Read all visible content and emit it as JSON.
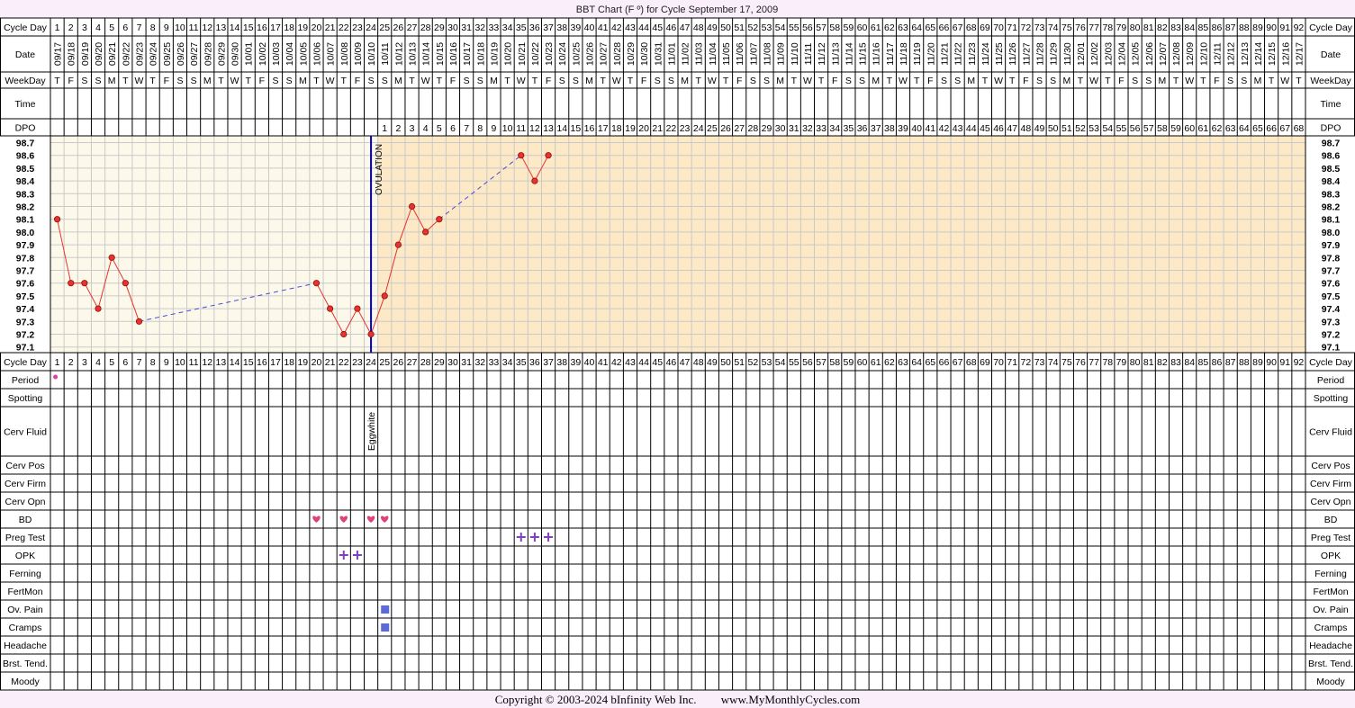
{
  "title": "BBT Chart (F º) for Cycle September 17, 2009",
  "row_labels": {
    "cycle_day": "Cycle Day",
    "date": "Date",
    "weekday": "WeekDay",
    "time": "Time",
    "dpo": "DPO",
    "cycle_day_2": "Cycle Day",
    "period": "Period",
    "spotting": "Spotting",
    "cerv_fluid": "Cerv Fluid",
    "cerv_pos": "Cerv Pos",
    "cerv_firm": "Cerv Firm",
    "cerv_opn": "Cerv Opn",
    "bd": "BD",
    "preg_test": "Preg Test",
    "opk": "OPK",
    "ferning": "Ferning",
    "fertmon": "FertMon",
    "ov_pain": "Ov. Pain",
    "cramps": "Cramps",
    "headache": "Headache",
    "brst_tend": "Brst. Tend.",
    "moody": "Moody"
  },
  "dates": [
    "09/17",
    "09/18",
    "09/19",
    "09/20",
    "09/21",
    "09/22",
    "09/23",
    "09/24",
    "09/25",
    "09/26",
    "09/27",
    "09/28",
    "09/29",
    "09/30",
    "10/01",
    "10/02",
    "10/03",
    "10/04",
    "10/05",
    "10/06",
    "10/07",
    "10/08",
    "10/09",
    "10/10",
    "10/11",
    "10/12",
    "10/13",
    "10/14",
    "10/15",
    "10/16",
    "10/17",
    "10/18",
    "10/19",
    "10/20",
    "10/21",
    "10/22",
    "10/23",
    "10/24",
    "10/25",
    "10/26",
    "10/27",
    "10/28",
    "10/29",
    "10/30",
    "10/31",
    "11/01",
    "11/02",
    "11/03",
    "11/04",
    "11/05",
    "11/06",
    "11/07",
    "11/08",
    "11/09",
    "11/10",
    "11/11",
    "11/12",
    "11/13",
    "11/14",
    "11/15",
    "11/16",
    "11/17",
    "11/18",
    "11/19",
    "11/20",
    "11/21",
    "11/22",
    "11/23",
    "11/24",
    "11/25",
    "11/26",
    "11/27",
    "11/28",
    "11/29",
    "11/30",
    "12/01",
    "12/02",
    "12/03",
    "12/04",
    "12/05",
    "12/06",
    "12/07",
    "12/08",
    "12/09",
    "12/10",
    "12/11",
    "12/12",
    "12/13",
    "12/14",
    "12/15",
    "12/16",
    "12/17"
  ],
  "weekdays": [
    "T",
    "F",
    "S",
    "S",
    "M",
    "T",
    "W",
    "T",
    "F",
    "S",
    "S",
    "M",
    "T",
    "W",
    "T",
    "F",
    "S",
    "S",
    "M",
    "T",
    "W",
    "T",
    "F",
    "S",
    "S",
    "M",
    "T",
    "W",
    "T",
    "F",
    "S",
    "S",
    "M",
    "T",
    "W",
    "T",
    "F",
    "S",
    "S",
    "M",
    "T",
    "W",
    "T",
    "F",
    "S",
    "S",
    "M",
    "T",
    "W",
    "T",
    "F",
    "S",
    "S",
    "M",
    "T",
    "W",
    "T",
    "F",
    "S",
    "S",
    "M",
    "T",
    "W",
    "T",
    "F",
    "S",
    "S",
    "M",
    "T",
    "W",
    "T",
    "F",
    "S",
    "S",
    "M",
    "T",
    "W",
    "T",
    "F",
    "S",
    "S",
    "M",
    "T",
    "W",
    "T",
    "F",
    "S",
    "S",
    "M",
    "T",
    "W",
    "T"
  ],
  "ovulation_label": "OVULATION",
  "cerv_fluid_entries": [
    {
      "day": 24,
      "label": "Eggwhite"
    }
  ],
  "markers": {
    "period": [
      1
    ],
    "bd": [
      20,
      22,
      24,
      25
    ],
    "preg_test": [
      35,
      36,
      37
    ],
    "opk": [
      22,
      23
    ],
    "ov_pain": [
      25
    ],
    "cramps": [
      25
    ]
  },
  "colors": {
    "page_bg": "#fbeefb",
    "grid_line": "#c9c9c9",
    "pre_ovulation_bg": "#fdf9ea",
    "post_ovulation_bg": "#fde9c6",
    "temp_line": "#e8322e",
    "ovulation_line": "#0000cc",
    "gap_line": "#4a4ad8",
    "bd_heart": "#e0407e",
    "plus_sign": "#8040c0",
    "square": "#5b6bd8",
    "period_dot": "#e0409e"
  },
  "footer": {
    "copyright": "Copyright © 2003-2024 bInfinity Web Inc.",
    "site": "www.MyMonthlyCycles.com"
  },
  "chart_data": {
    "type": "line",
    "title": "BBT Chart (F º) for Cycle September 17, 2009",
    "xlabel": "Cycle Day",
    "ylabel": "",
    "x_range": [
      1,
      92
    ],
    "ylim": [
      97.1,
      98.7
    ],
    "y_ticks": [
      "98.7",
      "98.6",
      "98.5",
      "98.4",
      "98.3",
      "98.2",
      "98.1",
      "98.0",
      "97.9",
      "97.8",
      "97.7",
      "97.6",
      "97.5",
      "97.4",
      "97.3",
      "97.2",
      "97.1"
    ],
    "ovulation_day": 24,
    "series": [
      {
        "points": [
          {
            "x": 1,
            "y": 98.1
          },
          {
            "x": 2,
            "y": 97.6
          },
          {
            "x": 3,
            "y": 97.6
          },
          {
            "x": 4,
            "y": 97.4
          },
          {
            "x": 5,
            "y": 97.8
          },
          {
            "x": 6,
            "y": 97.6
          },
          {
            "x": 7,
            "y": 97.3
          },
          {
            "x": 20,
            "y": 97.6
          },
          {
            "x": 21,
            "y": 97.4
          },
          {
            "x": 22,
            "y": 97.2
          },
          {
            "x": 23,
            "y": 97.4
          },
          {
            "x": 24,
            "y": 97.2
          },
          {
            "x": 25,
            "y": 97.5
          },
          {
            "x": 26,
            "y": 97.9
          },
          {
            "x": 27,
            "y": 98.2
          },
          {
            "x": 28,
            "y": 98.0
          },
          {
            "x": 29,
            "y": 98.1
          },
          {
            "x": 35,
            "y": 98.6
          },
          {
            "x": 36,
            "y": 98.4
          },
          {
            "x": 37,
            "y": 98.6
          }
        ]
      }
    ],
    "grid": true,
    "legend": "none"
  }
}
